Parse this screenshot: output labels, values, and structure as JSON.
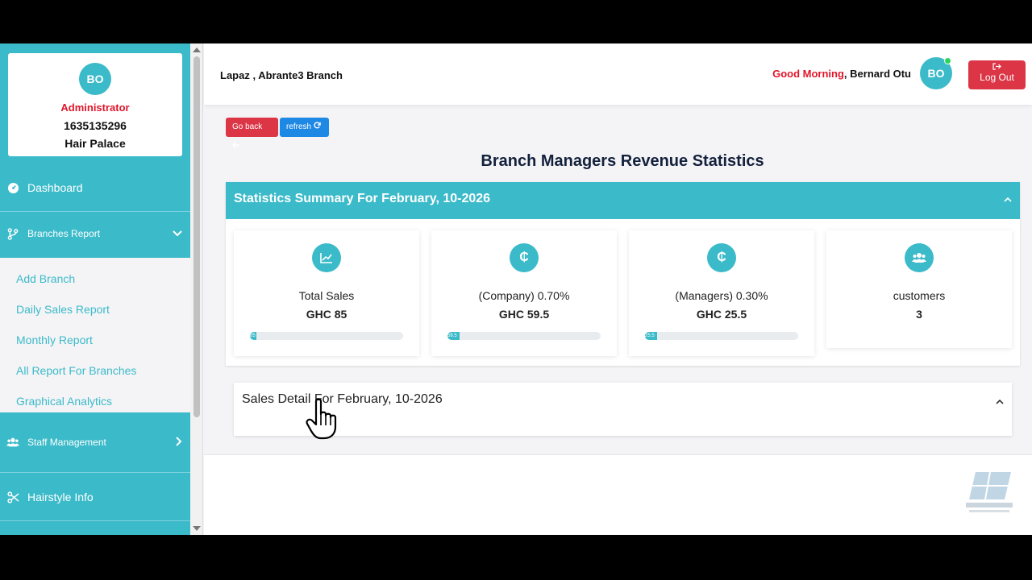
{
  "profile": {
    "initials": "BO",
    "role": "Administrator",
    "phone": "1635135296",
    "shop": "Hair Palace"
  },
  "sidebar": {
    "dashboard": "Dashboard",
    "branches_report": "Branches Report",
    "sub_items": [
      "Add Branch",
      "Daily Sales Report",
      "Monthly Report",
      "All Report For Branches",
      "Graphical Analytics"
    ],
    "staff_management": "Staff Management",
    "hairstyle_info": "Hairstyle Info"
  },
  "header": {
    "branch": "Lapaz , Abrante3 Branch",
    "greeting": "Good Morning",
    "user_name": "Bernard Otu",
    "user_initials": "BO",
    "logout": "Log Out"
  },
  "actions": {
    "go_back": "Go back",
    "refresh": "refresh"
  },
  "page_title": "Branch Managers Revenue Statistics",
  "summary": {
    "title": "Statistics Summary For February, 10-2026",
    "stats": [
      {
        "label": "Total Sales",
        "value": "GHC 85",
        "icon": "chart-line-icon",
        "progress_label": "85",
        "progress": 0.04
      },
      {
        "label": "(Company) 0.70%",
        "value": "GHC 59.5",
        "icon": "cedi-icon",
        "progress_label": "59.5",
        "progress": 0.08
      },
      {
        "label": "(Managers) 0.30%",
        "value": "GHC 25.5",
        "icon": "cedi-icon",
        "progress_label": "25.5",
        "progress": 0.08
      },
      {
        "label": "customers",
        "value": "3",
        "icon": "users-icon"
      }
    ]
  },
  "detail": {
    "title": "Sales Detail For February, 10-2026"
  },
  "colors": {
    "accent": "#3bbac9",
    "danger": "#dc3545",
    "primary": "#1e88e5"
  }
}
